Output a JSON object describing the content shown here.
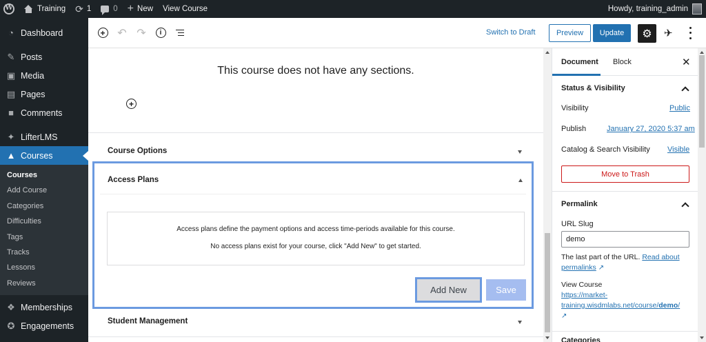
{
  "admin_bar": {
    "site_name": "Training",
    "updates_count": "1",
    "comments_count": "0",
    "new_label": "New",
    "view_label": "View Course",
    "howdy": "Howdy, training_admin"
  },
  "sidebar": {
    "items": [
      {
        "label": "Dashboard",
        "icon": "dashboard-icon"
      },
      {
        "label": "Posts",
        "icon": "pin-icon"
      },
      {
        "label": "Media",
        "icon": "media-icon"
      },
      {
        "label": "Pages",
        "icon": "pages-icon"
      },
      {
        "label": "Comments",
        "icon": "comments-icon"
      },
      {
        "label": "LifterLMS",
        "icon": "lifterlms-icon"
      },
      {
        "label": "Courses",
        "icon": "graduation-cap-icon"
      },
      {
        "label": "Memberships",
        "icon": "memberships-icon"
      },
      {
        "label": "Engagements",
        "icon": "engagements-icon"
      }
    ],
    "submenu": [
      "Courses",
      "Add Course",
      "Categories",
      "Difficulties",
      "Tags",
      "Tracks",
      "Lessons",
      "Reviews"
    ]
  },
  "editor_header": {
    "switch_to_draft": "Switch to Draft",
    "preview": "Preview",
    "update": "Update"
  },
  "content": {
    "no_sections": "This course does not have any sections.",
    "course_options": "Course Options",
    "access_plans": {
      "title": "Access Plans",
      "description": "Access plans define the payment options and access time-periods available for this course.",
      "empty_message": "No access plans exist for your course, click \"Add New\" to get started.",
      "add_new": "Add New",
      "save": "Save"
    },
    "student_management": "Student Management"
  },
  "settings": {
    "tabs": {
      "document": "Document",
      "block": "Block"
    },
    "status_visibility": {
      "title": "Status & Visibility",
      "visibility_label": "Visibility",
      "visibility_value": "Public",
      "publish_label": "Publish",
      "publish_value": "January 27, 2020 5:37 am",
      "catalog_label": "Catalog & Search Visibility",
      "catalog_value": "Visible",
      "trash": "Move to Trash"
    },
    "permalink": {
      "title": "Permalink",
      "slug_label": "URL Slug",
      "slug_value": "demo",
      "help_text": "The last part of the URL.",
      "read_about": "Read about",
      "permalinks": "permalinks",
      "view_course": "View Course",
      "url_line1": "https://market-",
      "url_line2": "training.wisdmlabs.net/course/",
      "url_slug": "demo",
      "url_end": "/"
    },
    "next_panel": "Categories"
  },
  "colors": {
    "admin_bg": "#1d2327",
    "accent": "#2271b1",
    "highlight_border": "#6b9ae0",
    "danger": "#cc1818"
  }
}
